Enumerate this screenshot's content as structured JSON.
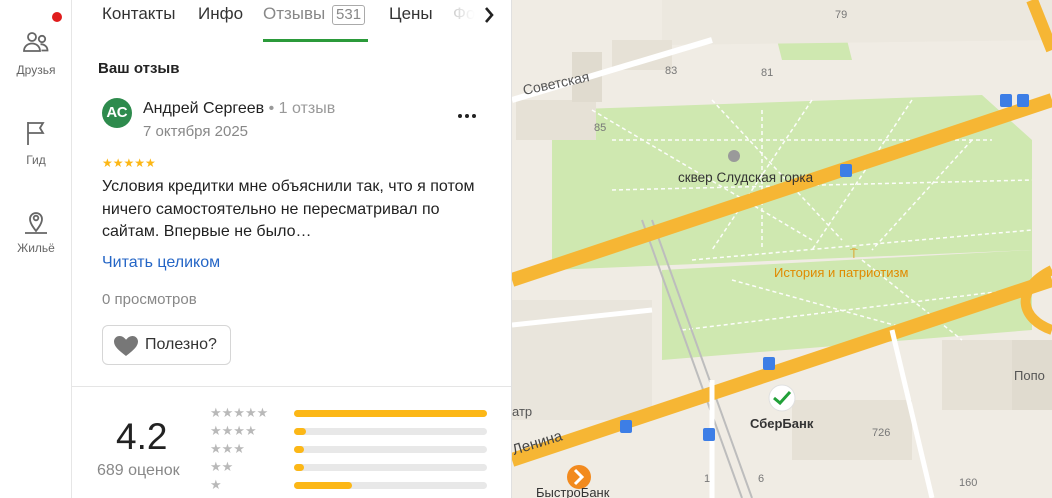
{
  "rail": {
    "items": [
      {
        "label": "Друзья",
        "icon": "friends-icon"
      },
      {
        "label": "Гид",
        "icon": "flag-icon"
      },
      {
        "label": "Жильё",
        "icon": "housing-icon"
      }
    ],
    "notification_color": "#e01c1c"
  },
  "tabs": {
    "items": [
      "Контакты",
      "Инфо",
      "Отзывы",
      "Цены",
      "Фо"
    ],
    "active": "Отзывы",
    "reviews_count": "531",
    "accent_color": "#2b9a3a"
  },
  "review": {
    "section_title": "Ваш отзыв",
    "avatar_initials": "АС",
    "author": "Андрей Сергеев",
    "author_meta": "1 отзыв",
    "date": "7 октября 2025",
    "rating": 5,
    "stars": "★★★★★",
    "text": "Условия кредитки мне объяснили так, что я потом ничего самостоятельно не пересматривал по сайтам. Впервые не было…",
    "read_more": "Читать целиком",
    "views": "0 просмотров",
    "useful_label": "Полезно?"
  },
  "summary": {
    "rating": "4.2",
    "count_label": "689 оценок",
    "distribution": [
      {
        "stars": "★★★★★",
        "fraction": 1.0
      },
      {
        "stars": "★★★★",
        "fraction": 0.06
      },
      {
        "stars": "★★★",
        "fraction": 0.05
      },
      {
        "stars": "★★",
        "fraction": 0.05
      },
      {
        "stars": "★",
        "fraction": 0.3
      }
    ],
    "bar_color": "#fcb716"
  },
  "map": {
    "labels": {
      "sovetskaya": "Советская",
      "lenina": "Ленина",
      "square": "сквер Слудская горка",
      "poi_history": "История и патриотизм",
      "sberbank": "СберБанк",
      "bystrobank": "БыстроБанк",
      "popov": "Попо",
      "theatre": "атр",
      "h79": "79",
      "h83": "83",
      "h81": "81",
      "h85": "85",
      "h726": "726",
      "h160": "160",
      "h1": "1",
      "h6": "6"
    },
    "road_color": "#f6b634",
    "park_color": "#cfe8b0"
  }
}
